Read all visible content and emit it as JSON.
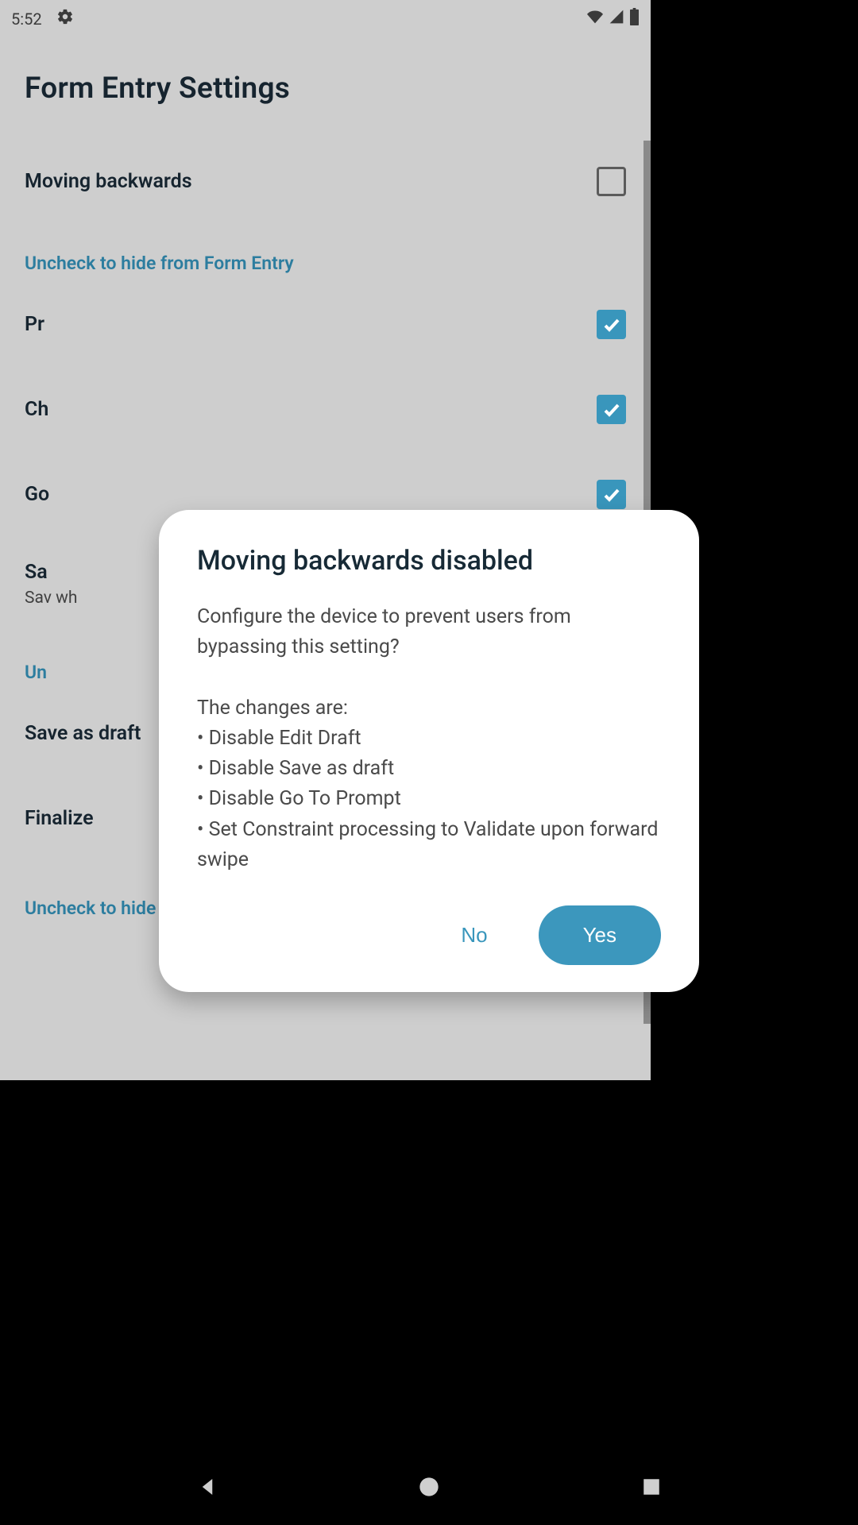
{
  "status": {
    "time": "5:52"
  },
  "header": {
    "title": "Form Entry Settings"
  },
  "prefs": {
    "moving_backwards": {
      "title": "Moving backwards",
      "checked": false
    },
    "section1": "Uncheck to hide from Form Entry",
    "p1": {
      "title": "Pr"
    },
    "p2": {
      "title": "Ch"
    },
    "p3": {
      "title": "Go"
    },
    "p4": {
      "title": "Sa",
      "sub": "Sav\nwh"
    },
    "section2": "Un",
    "save_as_draft": {
      "title": "Save as draft",
      "checked": true
    },
    "finalize": {
      "title": "Finalize",
      "checked": true
    },
    "section3": "Uncheck to hide from Drafts"
  },
  "dialog": {
    "title": "Moving backwards disabled",
    "body": "Configure the device to prevent users from bypassing this setting?\n\nThe changes are:\n• Disable Edit Draft\n• Disable Save as draft\n• Disable Go To Prompt\n• Set Constraint processing to Validate upon forward swipe",
    "no": "No",
    "yes": "Yes"
  }
}
